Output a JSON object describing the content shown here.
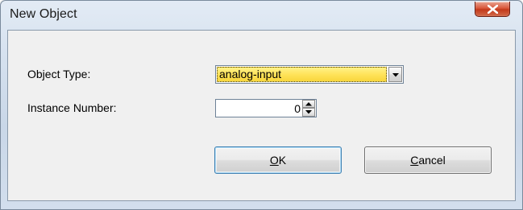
{
  "window": {
    "title": "New Object",
    "close_glyph": "x-icon"
  },
  "form": {
    "object_type_label": "Object Type:",
    "object_type_value": "analog-input",
    "instance_number_label": "Instance Number:",
    "instance_number_value": "0"
  },
  "buttons": {
    "ok_mnemonic": "O",
    "ok_rest": "K",
    "cancel_mnemonic": "C",
    "cancel_rest": "ancel"
  },
  "colors": {
    "selection_highlight": "#ffe35a",
    "close_button": "#c2391a",
    "default_button_border": "#3c7fb1"
  }
}
